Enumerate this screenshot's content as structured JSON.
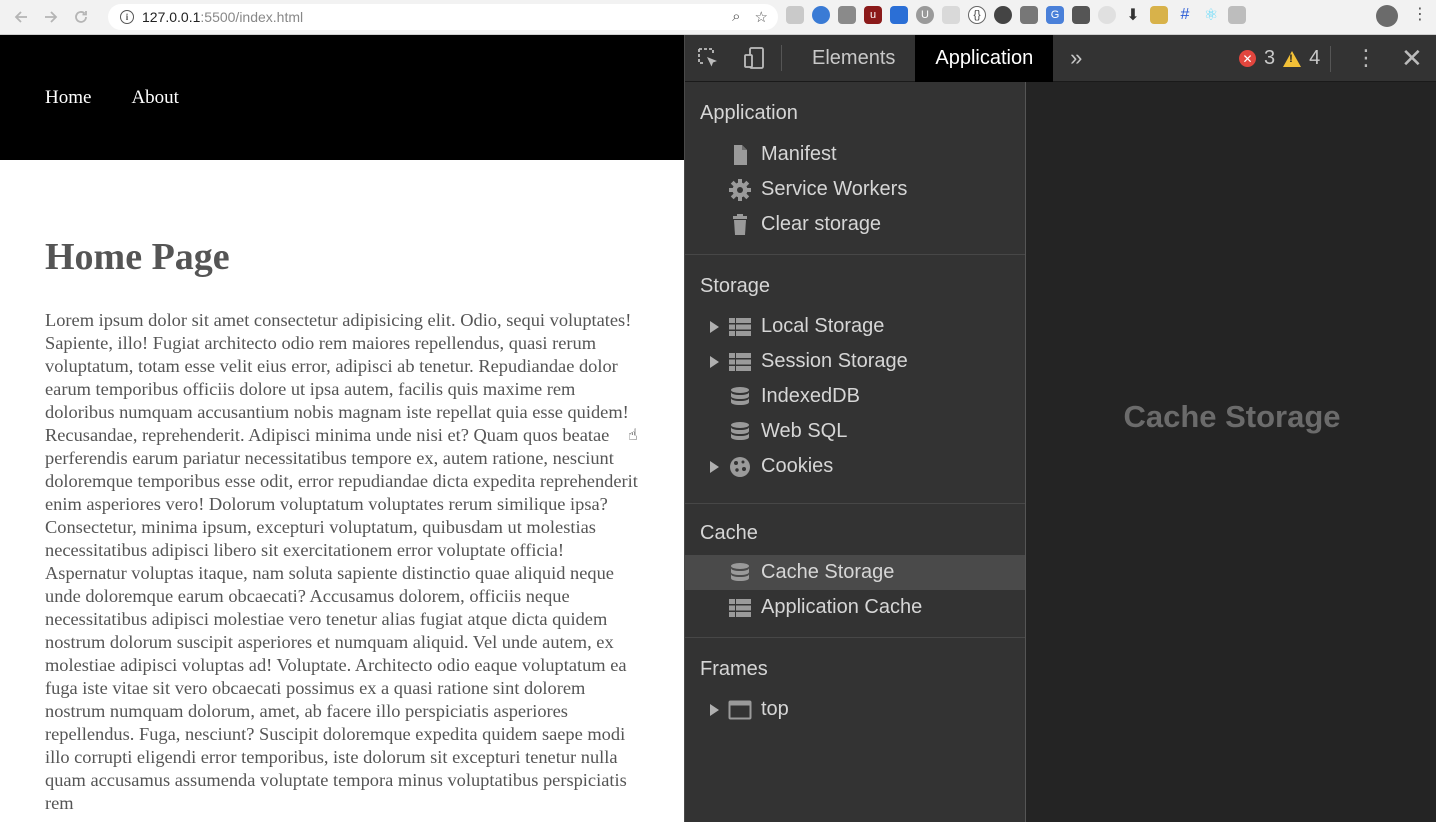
{
  "browser": {
    "url_host": "127.0.0.1",
    "url_rest": ":5500/index.html"
  },
  "site": {
    "nav": [
      "Home",
      "About"
    ],
    "title": "Home Page",
    "body": "Lorem ipsum dolor sit amet consectetur adipisicing elit. Odio, sequi voluptates! Sapiente, illo! Fugiat architecto odio rem maiores repellendus, quasi rerum voluptatum, totam esse velit eius error, adipisci ab tenetur. Repudiandae dolor earum temporibus officiis dolore ut ipsa autem, facilis quis maxime rem doloribus numquam accusantium nobis magnam iste repellat quia esse quidem! Recusandae, reprehenderit. Adipisci minima unde nisi et? Quam quos beatae perferendis earum pariatur necessitatibus tempore ex, autem ratione, nesciunt doloremque temporibus esse odit, error repudiandae dicta expedita reprehenderit enim asperiores vero! Dolorum voluptatum voluptates rerum similique ipsa? Consectetur, minima ipsum, excepturi voluptatum, quibusdam ut molestias necessitatibus adipisci libero sit exercitationem error voluptate officia! Aspernatur voluptas itaque, nam soluta sapiente distinctio quae aliquid neque unde doloremque earum obcaecati? Accusamus dolorem, officiis neque necessitatibus adipisci molestiae vero tenetur alias fugiat atque dicta quidem nostrum dolorum suscipit asperiores et numquam aliquid. Vel unde autem, ex molestiae adipisci voluptas ad! Voluptate. Architecto odio eaque voluptatum ea fuga iste vitae sit vero obcaecati possimus ex a quasi ratione sint dolorem nostrum numquam dolorum, amet, ab facere illo perspiciatis asperiores repellendus. Fuga, nesciunt? Suscipit doloremque expedita quidem saepe modi illo corrupti eligendi error temporibus, iste dolorum sit excepturi tenetur nulla quam accusamus assumenda voluptate tempora minus voluptatibus perspiciatis rem"
  },
  "devtools": {
    "tabs": [
      "Elements",
      "Application"
    ],
    "active_tab": "Application",
    "error_count": "3",
    "warning_count": "4",
    "sections": {
      "application": {
        "header": "Application",
        "items": [
          "Manifest",
          "Service Workers",
          "Clear storage"
        ]
      },
      "storage": {
        "header": "Storage",
        "items": [
          "Local Storage",
          "Session Storage",
          "IndexedDB",
          "Web SQL",
          "Cookies"
        ]
      },
      "cache": {
        "header": "Cache",
        "items": [
          "Cache Storage",
          "Application Cache"
        ]
      },
      "frames": {
        "header": "Frames",
        "items": [
          "top"
        ]
      }
    },
    "selected_item": "Cache Storage",
    "main_title": "Cache Storage"
  },
  "colors": {
    "devtools_panel": "#333333",
    "devtools_main": "#242424",
    "error": "#e2463e",
    "warning": "#f2c037"
  }
}
